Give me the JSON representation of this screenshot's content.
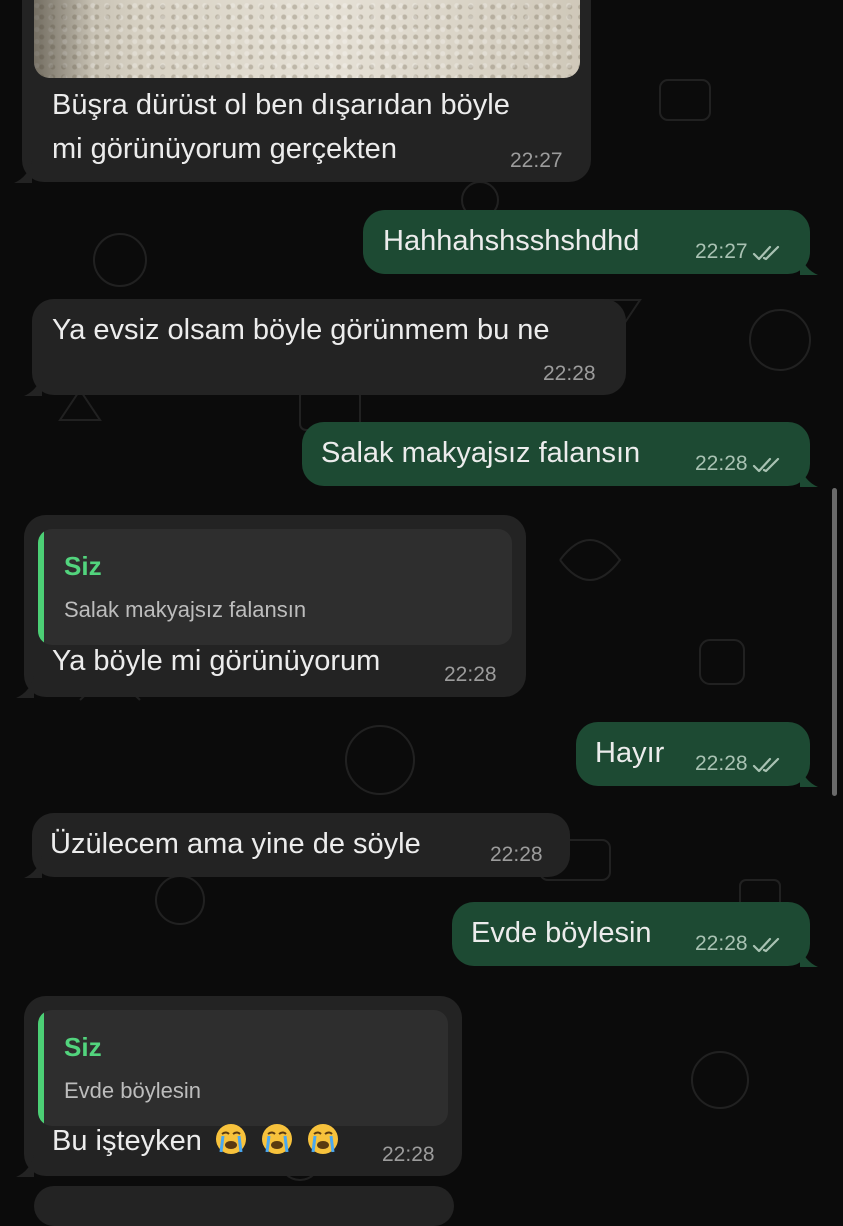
{
  "messages": [
    {
      "id": "m1",
      "dir": "in",
      "lines": [
        "Büşra dürüst ol ben dışarıdan böyle",
        "mi görünüyorum gerçekten"
      ],
      "time": "22:27",
      "has_photo": true
    },
    {
      "id": "m2",
      "dir": "out",
      "text": "Hahhahshsshshdhd",
      "time": "22:27",
      "read": true
    },
    {
      "id": "m3",
      "dir": "in",
      "text": "Ya evsiz olsam böyle görünmem bu ne",
      "time": "22:28"
    },
    {
      "id": "m4",
      "dir": "out",
      "text": "Salak makyajsız falansın",
      "time": "22:28",
      "read": true
    },
    {
      "id": "m5",
      "dir": "in",
      "text": "Ya böyle mi görünüyorum",
      "time": "22:28",
      "reply_to": {
        "author": "Siz",
        "text": "Salak makyajsız falansın"
      }
    },
    {
      "id": "m6",
      "dir": "out",
      "text": "Hayır",
      "time": "22:28",
      "read": true
    },
    {
      "id": "m7",
      "dir": "in",
      "text": "Üzülecem ama yine de söyle",
      "time": "22:28"
    },
    {
      "id": "m8",
      "dir": "out",
      "text": "Evde böylesin",
      "time": "22:28",
      "read": true
    },
    {
      "id": "m9",
      "dir": "in",
      "text": "Bu işteyken",
      "emoji": [
        "loudly-crying-face",
        "loudly-crying-face",
        "loudly-crying-face"
      ],
      "time": "22:28",
      "reply_to": {
        "author": "Siz",
        "text": "Evde böylesin"
      }
    }
  ],
  "colors": {
    "background": "#0b0b0b",
    "incoming_bubble": "#232323",
    "outgoing_bubble": "#1d4a33",
    "quote_accent": "#4ccf75",
    "read_ticks": "#a9c2b3"
  }
}
